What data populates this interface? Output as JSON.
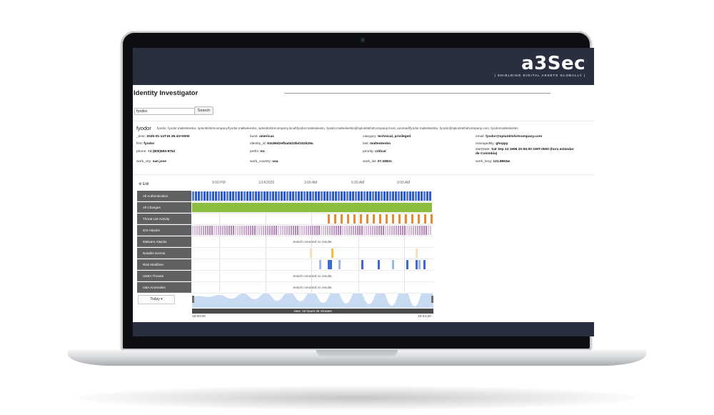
{
  "brand": {
    "logo": "a3Sec",
    "tagline": "| SHIELDING DIGITAL ASSETS GLOBALLY |"
  },
  "page": {
    "title": "Identity Investigator"
  },
  "search": {
    "value": "fyodor",
    "button": "Search"
  },
  "identity": {
    "name": "fyodor",
    "aliases": "fyodor, fyodor.malteskesko, splunktshirtcompany\\fyodor.malteskesko, splunktshirtcompany.local\\fyodor.malteskesko, fyodor.malteskesko@splunktshirtcompany.local, azuread\\fyodor.malteskesko, fyodor@splunktshirtcompany.com, fyodormalteskesko",
    "fields": [
      {
        "key": "_time:",
        "value": "2025-01-14T15:35:43+0000"
      },
      {
        "key": "bunit:",
        "value": "americas"
      },
      {
        "key": "category:",
        "value": "technical, privileged"
      },
      {
        "key": "email:",
        "value": "fyodor@splunktshirtcompany.com"
      },
      {
        "key": "first:",
        "value": "fyodor"
      },
      {
        "key": "identity_id:",
        "value": "63c86d2efba0433bd152b29a"
      },
      {
        "key": "last:",
        "value": "malteskesko"
      },
      {
        "key": "managedBy:",
        "value": "ghoppy"
      },
      {
        "key": "phone:",
        "value": "+1 (800)555-8762"
      },
      {
        "key": "prefix:",
        "value": "mr."
      },
      {
        "key": "priority:",
        "value": "critical"
      },
      {
        "key": "startDate:",
        "value": "Sat Sep 14 1996 20:55:00 GMT-0500 (hora estándar de Colombia)"
      },
      {
        "key": "work_city:",
        "value": "san jose"
      },
      {
        "key": "work_country:",
        "value": "usa"
      },
      {
        "key": "work_lat:",
        "value": "37.3382n"
      },
      {
        "key": "work_long:",
        "value": "121.8863w"
      }
    ]
  },
  "timeline": {
    "edit_label": "Edit",
    "ticks": [
      "9:00 PM",
      "1/14/2025",
      "3:00 AM",
      "6:00 AM",
      "9:00 AM"
    ],
    "lanes": [
      {
        "label": "All Authentication",
        "color": "#2f5bd3",
        "pattern": "dense"
      },
      {
        "label": "All Changes",
        "color": "#8cbd3c",
        "pattern": "solid"
      },
      {
        "label": "Threat List Activity",
        "color": "#e78a2e",
        "pattern": "sparse-end"
      },
      {
        "label": "IDS Attacks",
        "color": "#9a5fa0",
        "pattern": "dense-light"
      },
      {
        "label": "Malware Attacks",
        "color": "",
        "pattern": "none"
      },
      {
        "label": "Notable Events",
        "color": "#f2c133",
        "pattern": "few"
      },
      {
        "label": "Risk Modifiers",
        "color": "#3d6bd6",
        "pattern": "scattered"
      },
      {
        "label": "UEBA Threats",
        "color": "",
        "pattern": "none"
      },
      {
        "label": "UBA Anomalies",
        "color": "",
        "pattern": "none"
      }
    ],
    "no_results": "Search returned no results.",
    "today_button": "Today ▾",
    "view_label": "view: 15 hours 36 minutes",
    "range_start": "19:00:00",
    "range_end": "10:34:20"
  }
}
